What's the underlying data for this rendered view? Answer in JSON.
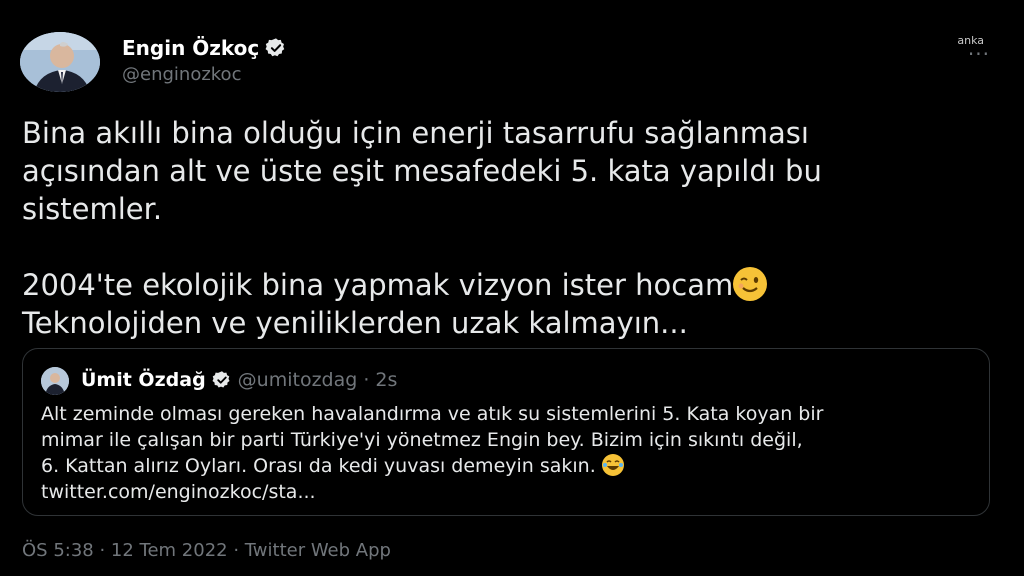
{
  "author": {
    "name": "Engin Özkoç",
    "handle": "@enginozkoc"
  },
  "watermark": "anka",
  "more_glyph": "···",
  "tweet": {
    "lines_p1": [
      "Bina akıllı bina olduğu için enerji tasarrufu sağlanması",
      "açısından alt ve üste eşit mesafedeki 5. kata yapıldı bu",
      "sistemler."
    ],
    "line_p2a": "2004'te ekolojik bina yapmak vizyon ister hocam",
    "line_p2b": "Teknolojiden ve yeniliklerden uzak kalmayın..."
  },
  "quote": {
    "name": "Ümit Özdağ",
    "handle": "@umitozdag",
    "dot": "·",
    "time": "2s",
    "lines": [
      "Alt zeminde olması gereken havalandırma ve atık su sistemlerini 5. Kata koyan bir",
      "mimar ile çalışan bir parti Türkiye'yi yönetmez Engin bey. Bizim için sıkıntı değil,",
      "6. Kattan alırız Oyları. Orası da kedi yuvası demeyin sakın.",
      "twitter.com/enginozkoc/sta..."
    ]
  },
  "meta": "ÖS 5:38 · 12 Tem 2022 · Twitter Web App",
  "colors": {
    "background": "#000000",
    "text": "#e7e9ea",
    "secondary": "#71767b",
    "border": "#2f3336",
    "emoji": "#f6c237"
  },
  "icons": [
    "verified-badge-icon",
    "wink-emoji-icon",
    "laughing-tears-emoji-icon",
    "more-icon"
  ]
}
